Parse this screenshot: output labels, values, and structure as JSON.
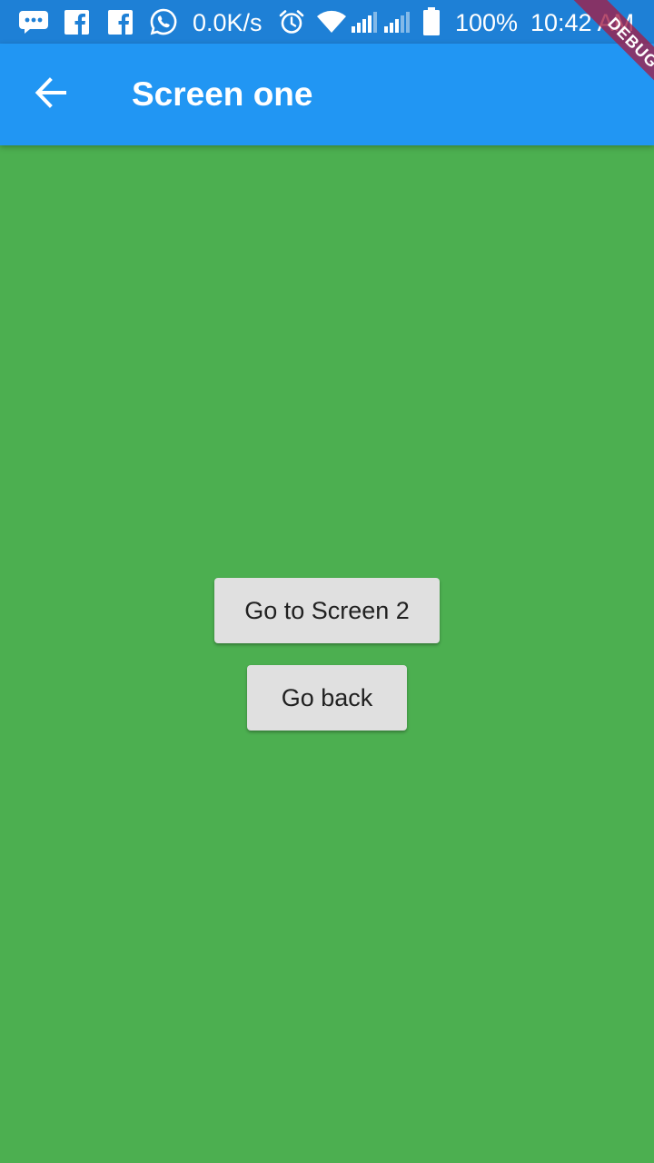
{
  "status_bar": {
    "icons": [
      "sms-icon",
      "facebook-icon",
      "facebook-icon",
      "whatsapp-icon",
      "alarm-icon",
      "wifi-icon",
      "signal-icon",
      "signal-icon",
      "battery-icon"
    ],
    "network_speed": "0.0K/s",
    "battery_percent": "100%",
    "time": "10:42 AM"
  },
  "app_bar": {
    "back_icon": "arrow-back-icon",
    "title": "Screen one"
  },
  "content": {
    "background_color": "#4CAF50",
    "buttons": [
      {
        "label": "Go to Screen 2"
      },
      {
        "label": "Go back"
      }
    ]
  },
  "debug_banner": {
    "label": "DEBUG"
  },
  "colors": {
    "status_bar": "#1E80D6",
    "app_bar": "#2196F3",
    "button_bg": "#E0E0E0",
    "banner": "#A31E46"
  }
}
